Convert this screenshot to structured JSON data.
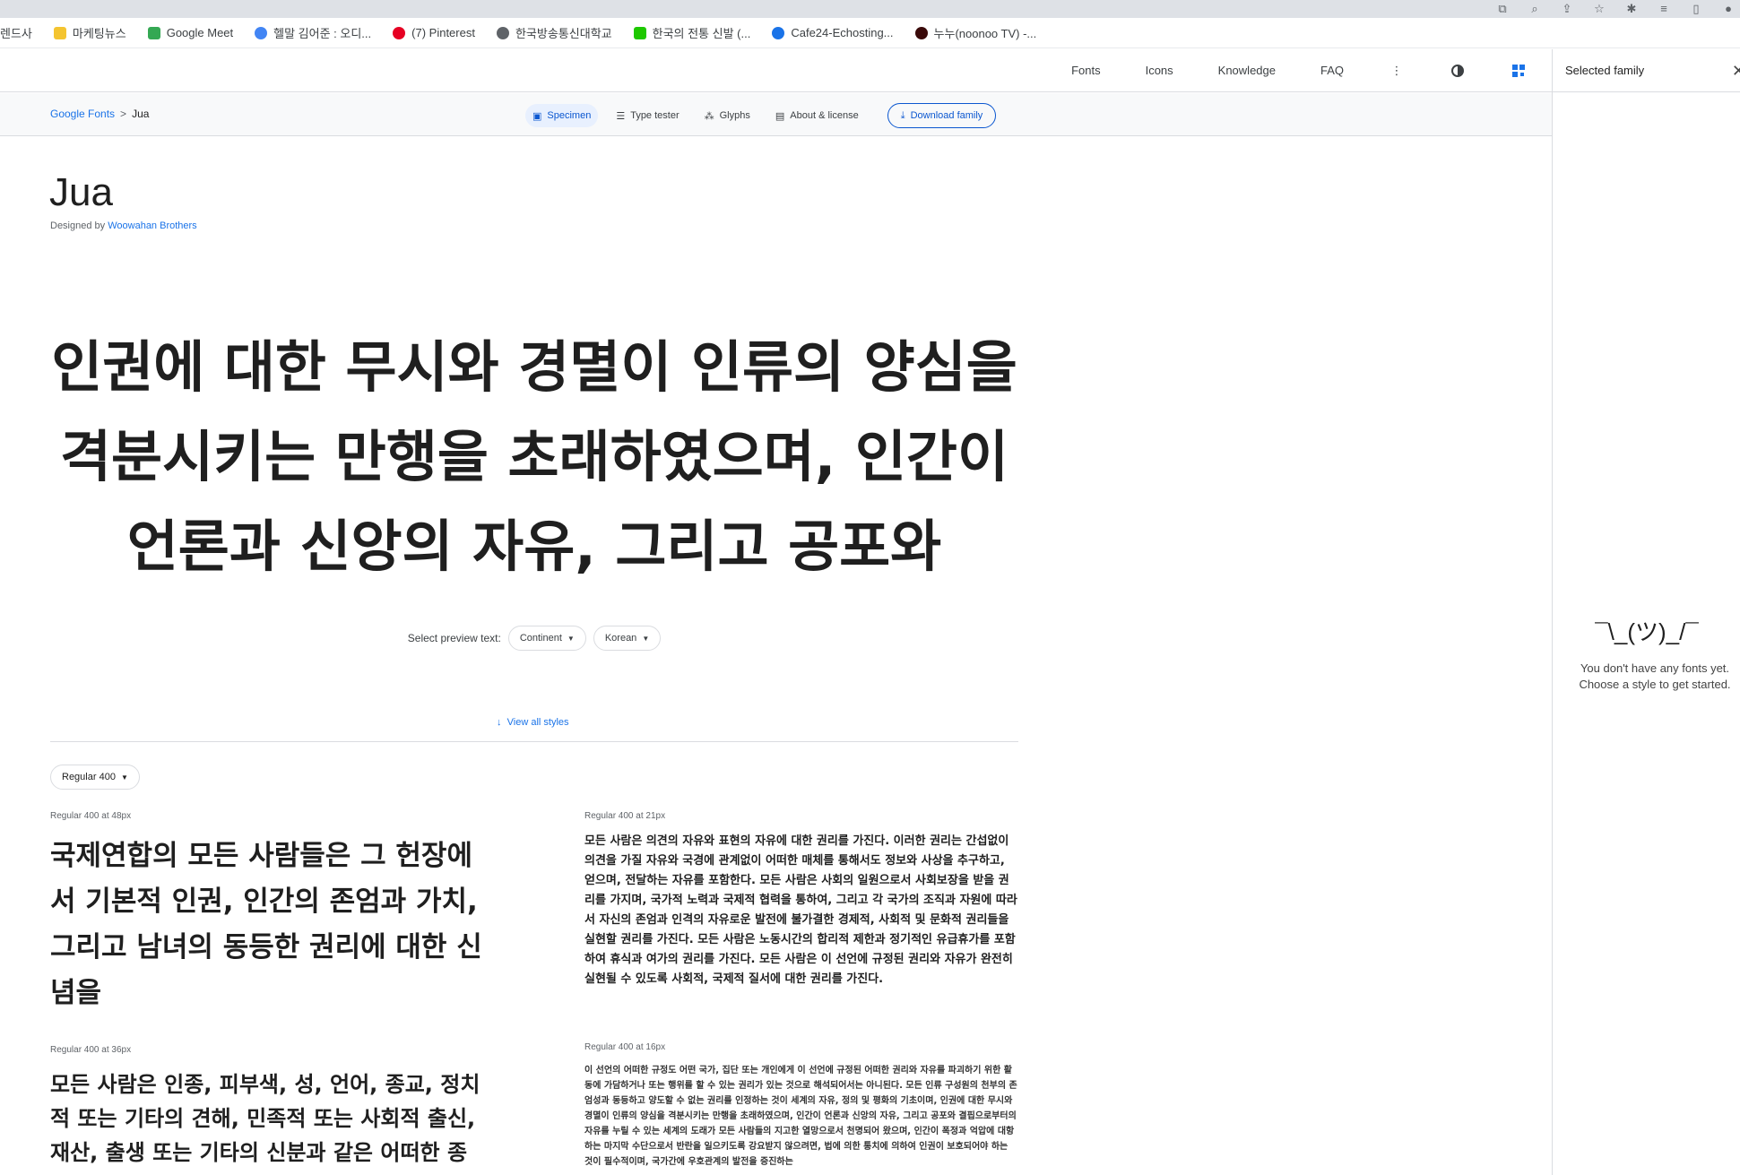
{
  "bookmarks": [
    {
      "label": "렌드사",
      "color": "#ffffff"
    },
    {
      "label": "마케팅뉴스",
      "color": "#f4c430"
    },
    {
      "label": "Google Meet",
      "color": "#34a853"
    },
    {
      "label": "헬말 김어준 : 오디...",
      "color": "#4285f4"
    },
    {
      "label": "(7) Pinterest",
      "color": "#e60023"
    },
    {
      "label": "한국방송통신대학교",
      "color": "#5f6368"
    },
    {
      "label": "한국의 전통 신발 (...",
      "color": "#1ec800"
    },
    {
      "label": "Cafe24-Echosting...",
      "color": "#1a73e8"
    },
    {
      "label": "누누(noonoo TV) -...",
      "color": "#8b0000"
    }
  ],
  "nav": {
    "items": [
      "Fonts",
      "Icons",
      "Knowledge",
      "FAQ"
    ]
  },
  "side": {
    "title": "Selected family",
    "shrug": "¯\\_(ツ)_/¯",
    "line1": "You don't have any fonts yet.",
    "line2": "Choose a style to get started."
  },
  "breadcrumb": {
    "root": "Google Fonts",
    "sep": ">",
    "current": "Jua"
  },
  "tabs": {
    "specimen": "Specimen",
    "type_tester": "Type tester",
    "glyphs": "Glyphs",
    "about": "About & license",
    "download": "Download family"
  },
  "font": {
    "name": "Jua",
    "designed_by": "Designed by",
    "designer": "Woowahan Brothers"
  },
  "hero_text": "인권에 대한 무시와 경멸이 인류의 양심을 격분시키는 만행을 초래하였으며, 인간이 언론과 신앙의 자유, 그리고 공포와",
  "preview": {
    "label": "Select preview text:",
    "option1": "Continent",
    "option2": "Korean"
  },
  "view_all": "View all styles",
  "weight_select": "Regular 400",
  "samples": {
    "s48_label": "Regular 400 at 48px",
    "s48_text": "국제연합의 모든 사람들은 그 헌장에서 기본적 인권, 인간의 존엄과 가치, 그리고 남녀의 동등한 권리에 대한 신념을",
    "s36_label": "Regular 400 at 36px",
    "s36_text": "모든 사람은 인종, 피부색, 성, 언어, 종교, 정치적 또는 기타의 견해, 민족적 또는 사회적 출신, 재산, 출생 또는 기타의 신분과 같은 어떠한 종",
    "s21_label": "Regular 400 at 21px",
    "s21_text": "모든 사람은 의견의 자유와 표현의 자유에 대한 권리를 가진다. 이러한 권리는 간섭없이 의견을 가질 자유와 국경에 관계없이 어떠한 매체를 통해서도 정보와 사상을 추구하고, 얻으며, 전달하는 자유를 포함한다. 모든 사람은 사회의 일원으로서 사회보장을 받을 권리를 가지며, 국가적 노력과 국제적 협력을 통하여, 그리고 각 국가의 조직과 자원에 따라서 자신의 존엄과 인격의 자유로운 발전에 불가결한 경제적, 사회적 및 문화적 권리들을 실현할 권리를 가진다. 모든 사람은 노동시간의 합리적 제한과 정기적인 유급휴가를 포함하여 휴식과 여가의 권리를 가진다. 모든 사람은 이 선언에 규정된 권리와 자유가 완전히 실현될 수 있도록 사회적, 국제적 질서에 대한 권리를 가진다.",
    "s16_label": "Regular 400 at 16px",
    "s16_text": "이 선언의 어떠한 규정도 어떤 국가, 집단 또는 개인에게 이 선언에 규정된 어떠한 권리와 자유를 파괴하기 위한 활동에 가담하거나 또는 행위를 할 수 있는 권리가 있는 것으로 해석되어서는 아니된다. 모든 인류 구성원의 천부의 존엄성과 동등하고 양도할 수 없는 권리를 인정하는 것이 세계의 자유, 정의 및 평화의 기초이며, 인권에 대한 무시와 경멸이 인류의 양심을 격분시키는 만행을 초래하였으며, 인간이 언론과 신앙의 자유, 그리고 공포와 결핍으로부터의 자유를 누릴 수 있는 세계의 도래가 모든 사람들의 지고한 열망으로서 천명되어 왔으며, 인간이 폭정과 억압에 대항하는 마지막 수단으로서 반란을 일으키도록 강요받지 않으려면, 법에 의한 통치에 의하여 인권이 보호되어야 하는 것이 필수적이며, 국가간에 우호관계의 발전을 증진하는"
  },
  "colors": {
    "accent": "#0b57d0",
    "link": "#1a73e8"
  }
}
